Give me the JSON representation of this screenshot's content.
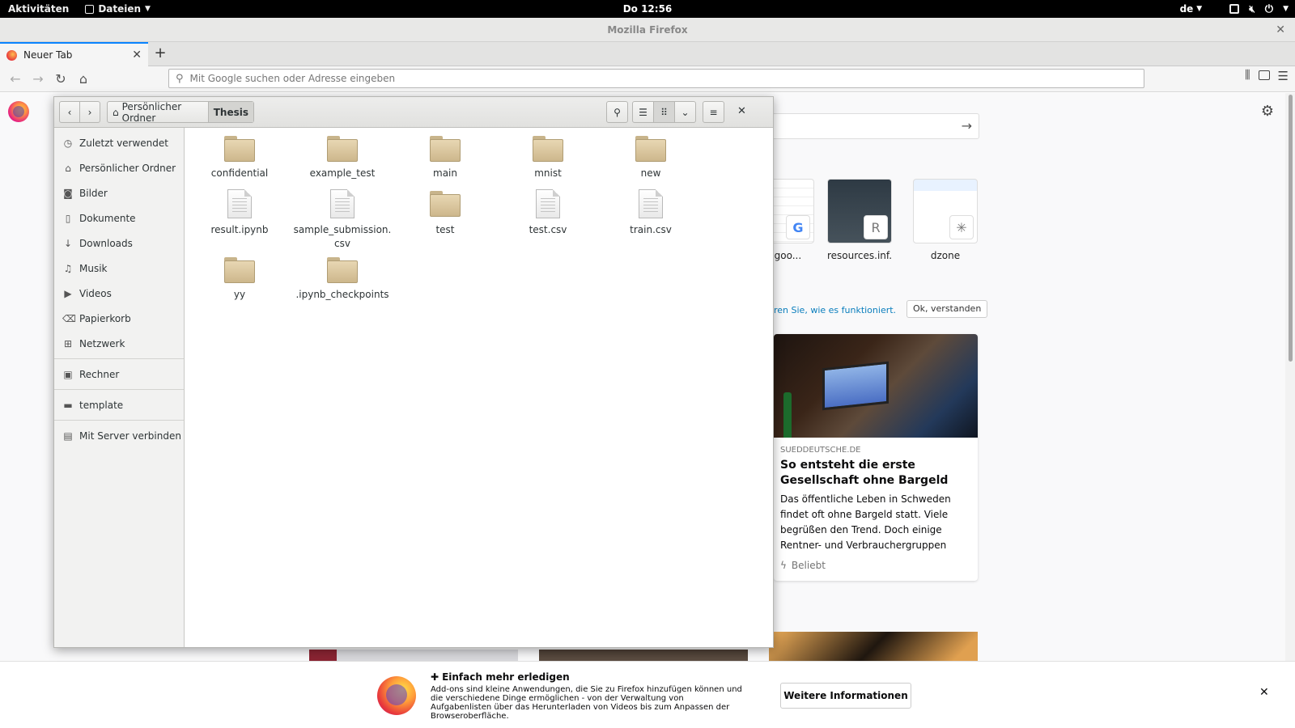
{
  "topbar": {
    "activities": "Aktivitäten",
    "app_menu": "Dateien",
    "clock": "Do 12:56",
    "keyboard_layout": "de"
  },
  "firefox": {
    "window_title": "Mozilla Firefox",
    "tab_label": "Neuer Tab",
    "url_placeholder": "Mit Google suchen oder Adresse eingeben",
    "tiles": [
      {
        "label": "ts.goo...",
        "badge": "G"
      },
      {
        "label": "resources.inf...",
        "badge": "R"
      },
      {
        "label": "dzone",
        "badge": ""
      }
    ],
    "howto_link": "ren Sie, wie es funktioniert.",
    "ok_button": "Ok, verstanden",
    "story": {
      "source": "SUEDDEUTSCHE.DE",
      "title": "So entsteht die erste Gesellschaft ohne Bargeld",
      "description": "Das öffentliche Leben in Schweden findet oft ohne Bargeld statt. Viele begrüßen den Trend. Doch einige Rentner- und Verbrauchergruppen",
      "meta": "Beliebt"
    },
    "notification": {
      "title": "Einfach mehr erledigen",
      "text": "Add-ons sind kleine Anwendungen, die Sie zu Firefox hinzufügen können und die verschiedene Dinge ermöglichen - von der Verwaltung von Aufgabenlisten über das Herunterladen von Videos bis zum Anpassen der Browseroberfläche.",
      "button": "Weitere Informationen"
    }
  },
  "file_manager": {
    "breadcrumb": {
      "home": "Persönlicher Ordner",
      "current": "Thesis"
    },
    "sidebar": {
      "group1": [
        {
          "label": "Zuletzt verwendet",
          "icon": "clock-icon"
        },
        {
          "label": "Persönlicher Ordner",
          "icon": "home-icon"
        },
        {
          "label": "Bilder",
          "icon": "camera-icon"
        },
        {
          "label": "Dokumente",
          "icon": "document-icon"
        },
        {
          "label": "Downloads",
          "icon": "download-icon"
        },
        {
          "label": "Musik",
          "icon": "music-icon"
        },
        {
          "label": "Videos",
          "icon": "video-icon"
        },
        {
          "label": "Papierkorb",
          "icon": "trash-icon"
        },
        {
          "label": "Netzwerk",
          "icon": "network-icon"
        }
      ],
      "group2": [
        {
          "label": "Rechner",
          "icon": "computer-icon"
        }
      ],
      "group3": [
        {
          "label": "template",
          "icon": "folder-icon"
        }
      ],
      "group4": [
        {
          "label": "Mit Server verbinden",
          "icon": "server-icon"
        }
      ]
    },
    "items": [
      {
        "name": "confidential",
        "type": "folder"
      },
      {
        "name": "example_test",
        "type": "folder"
      },
      {
        "name": "main",
        "type": "folder"
      },
      {
        "name": "mnist",
        "type": "folder"
      },
      {
        "name": "new",
        "type": "folder"
      },
      {
        "name": "result.ipynb",
        "type": "file"
      },
      {
        "name": "sample_submission.\ncsv",
        "type": "file"
      },
      {
        "name": "test",
        "type": "folder"
      },
      {
        "name": "test.csv",
        "type": "file"
      },
      {
        "name": "train.csv",
        "type": "file"
      },
      {
        "name": "yy",
        "type": "folder"
      },
      {
        "name": ".ipynb_checkpoints",
        "type": "folder"
      }
    ]
  }
}
